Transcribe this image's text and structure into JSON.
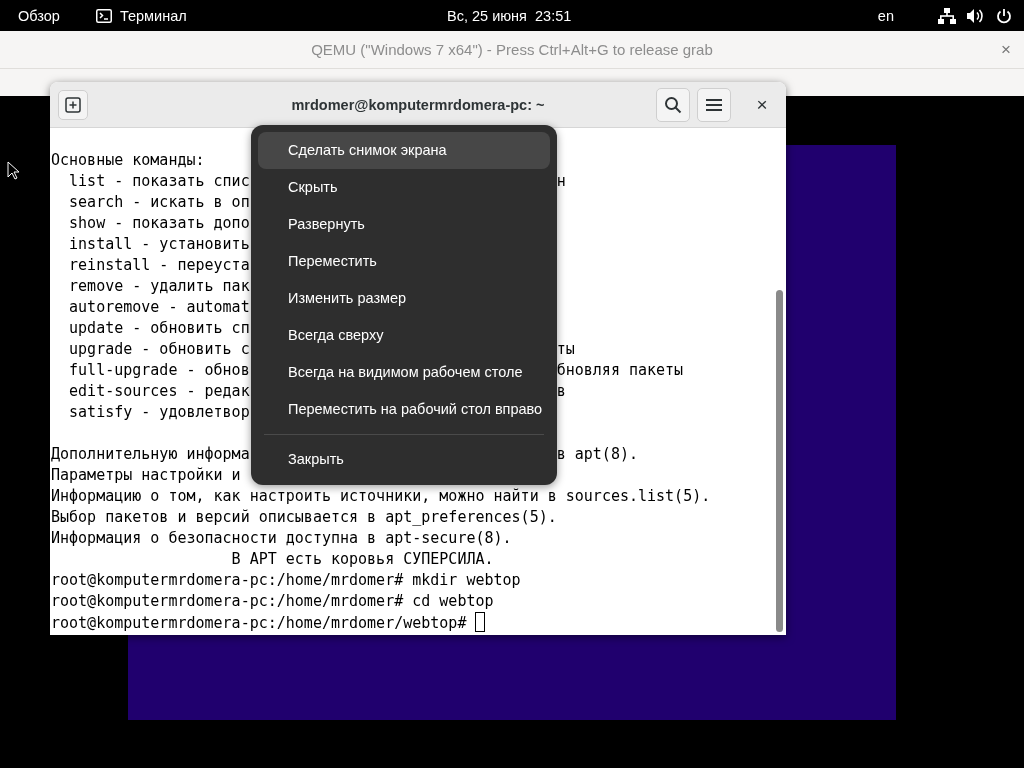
{
  "top_bar": {
    "activities": "Обзор",
    "app": "Терминал",
    "clock": "Вс, 25 июня  23:51",
    "keyboard": "en"
  },
  "qemu": {
    "title": "QEMU (\"Windows 7 x64\") - Press Ctrl+Alt+G to release grab",
    "close": "×"
  },
  "terminal": {
    "title": "mrdomer@komputermrdomera-pc: ~",
    "close": "×",
    "lines": [
      {
        "kind": "text",
        "left": "Основные команды:"
      },
      {
        "kind": "text",
        "left": "  list - показать спис",
        "right": "н"
      },
      {
        "kind": "text",
        "left": "  search - искать в оп"
      },
      {
        "kind": "text",
        "left": "  show - показать допо"
      },
      {
        "kind": "text",
        "left": "  install - установить"
      },
      {
        "kind": "text",
        "left": "  reinstall - переуста"
      },
      {
        "kind": "text",
        "left": "  remove - удалить пак"
      },
      {
        "kind": "text",
        "left": "  autoremove - automat"
      },
      {
        "kind": "text",
        "left": "  update - обновить сп"
      },
      {
        "kind": "text",
        "left": "  upgrade - обновить с",
        "right": "ты"
      },
      {
        "kind": "text",
        "left": "  full-upgrade - обнов",
        "right": "бновляя пакеты"
      },
      {
        "kind": "text",
        "left": "  edit-sources - редак",
        "right": "в"
      },
      {
        "kind": "text",
        "left": "  satisfy - удовлетвор"
      },
      {
        "kind": "blank"
      },
      {
        "kind": "text",
        "left": "Дополнительную информа",
        "right": "в apt(8)."
      },
      {
        "kind": "text",
        "left": "Параметры настройки и"
      },
      {
        "kind": "text",
        "left": "Информацию о том, как настроить источники, можно найти в sources.list(5)."
      },
      {
        "kind": "text",
        "left": "Выбор пакетов и версий описывается в apt_preferences(5)."
      },
      {
        "kind": "text",
        "left": "Информация о безопасности доступна в apt-secure(8)."
      },
      {
        "kind": "text",
        "left": "                    В APT есть коровья СУПЕРСИЛА."
      },
      {
        "kind": "text",
        "left": "root@komputermrdomera-pc:/home/mrdomer# mkdir webtop"
      },
      {
        "kind": "text",
        "left": "root@komputermrdomera-pc:/home/mrdomer# cd webtop"
      },
      {
        "kind": "text",
        "left": "root@komputermrdomera-pc:/home/mrdomer/webtop# ",
        "cursor": true
      }
    ]
  },
  "context_menu": {
    "items": [
      {
        "label": "Сделать снимок экрана",
        "selected": true,
        "separator_before": false
      },
      {
        "label": "Скрыть",
        "selected": false,
        "separator_before": false
      },
      {
        "label": "Развернуть",
        "selected": false,
        "separator_before": false
      },
      {
        "label": "Переместить",
        "selected": false,
        "separator_before": false
      },
      {
        "label": "Изменить размер",
        "selected": false,
        "separator_before": false
      },
      {
        "label": "Всегда сверху",
        "selected": false,
        "separator_before": false
      },
      {
        "label": "Всегда на видимом рабочем столе",
        "selected": false,
        "separator_before": false
      },
      {
        "label": "Переместить на рабочий стол вправо",
        "selected": false,
        "separator_before": false
      },
      {
        "label": "Закрыть",
        "selected": false,
        "separator_before": true
      }
    ]
  }
}
